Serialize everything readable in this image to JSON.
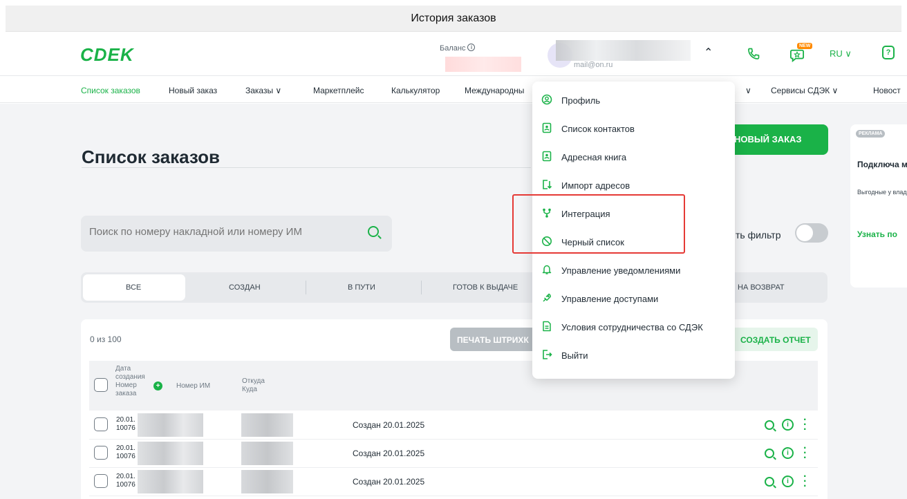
{
  "window": {
    "title": "История заказов"
  },
  "header": {
    "logo": "CDEK",
    "balance_label": "Баланс",
    "user_email": "mail@on.ru",
    "new_badge": "NEW",
    "lang": "RU ∨",
    "help_icon": "?"
  },
  "nav": {
    "items": [
      {
        "label": "Список заказов"
      },
      {
        "label": "Новый заказ"
      },
      {
        "label": "Заказы ∨"
      },
      {
        "label": "Маркетплейс"
      },
      {
        "label": "Калькулятор"
      },
      {
        "label": "Международны"
      },
      {
        "label": "∨"
      },
      {
        "label": "Сервисы СДЭК ∨"
      },
      {
        "label": "Новост"
      }
    ]
  },
  "page": {
    "title": "Список заказов",
    "new_order_button": "НОВЫЙ ЗАКАЗ",
    "search_placeholder": "Поиск по номеру накладной или номеру ИМ",
    "filter_label": "ть фильтр"
  },
  "status_tabs": [
    {
      "label": "ВСЕ"
    },
    {
      "label": "СОЗДАН"
    },
    {
      "label": "В ПУТИ"
    },
    {
      "label": "ГОТОВ К ВЫДАЧЕ"
    },
    {
      "label": "НА ВОЗВРАТ"
    }
  ],
  "table": {
    "count": "0 из 100",
    "print_button": "ПЕЧАТЬ ШТРИХК",
    "report_button": "СОЗДАТЬ ОТЧЕТ",
    "headers": {
      "date_number": "Дата создания Номер заказа",
      "shop_number": "Номер ИМ",
      "from_to": "Откуда Куда"
    },
    "rows": [
      {
        "date": "20.01.",
        "number": "10076",
        "status": "Создан 20.01.2025"
      },
      {
        "date": "20.01.",
        "number": "10076",
        "status": "Создан 20.01.2025"
      },
      {
        "date": "20.01.",
        "number": "10076",
        "status": "Создан 20.01.2025"
      }
    ]
  },
  "ad": {
    "badge": "РЕКЛАМА",
    "title": "Подключа магазин к",
    "text": "Выгодные у владельцев на все серви",
    "link": "Узнать по"
  },
  "menu": {
    "items": [
      {
        "label": "Профиль",
        "icon": "user-circle-icon"
      },
      {
        "label": "Список контактов",
        "icon": "contacts-icon"
      },
      {
        "label": "Адресная книга",
        "icon": "address-book-icon"
      },
      {
        "label": "Импорт адресов",
        "icon": "import-icon"
      },
      {
        "label": "Интеграция",
        "icon": "integration-icon"
      },
      {
        "label": "Черный список",
        "icon": "block-icon"
      },
      {
        "label": "Управление уведомлениями",
        "icon": "bell-icon"
      },
      {
        "label": "Управление доступами",
        "icon": "access-icon"
      },
      {
        "label": "Условия сотрудничества со СДЭК",
        "icon": "document-icon"
      },
      {
        "label": "Выйти",
        "icon": "logout-icon"
      }
    ]
  },
  "colors": {
    "brand": "#1ab248",
    "highlight": "#e53935"
  }
}
